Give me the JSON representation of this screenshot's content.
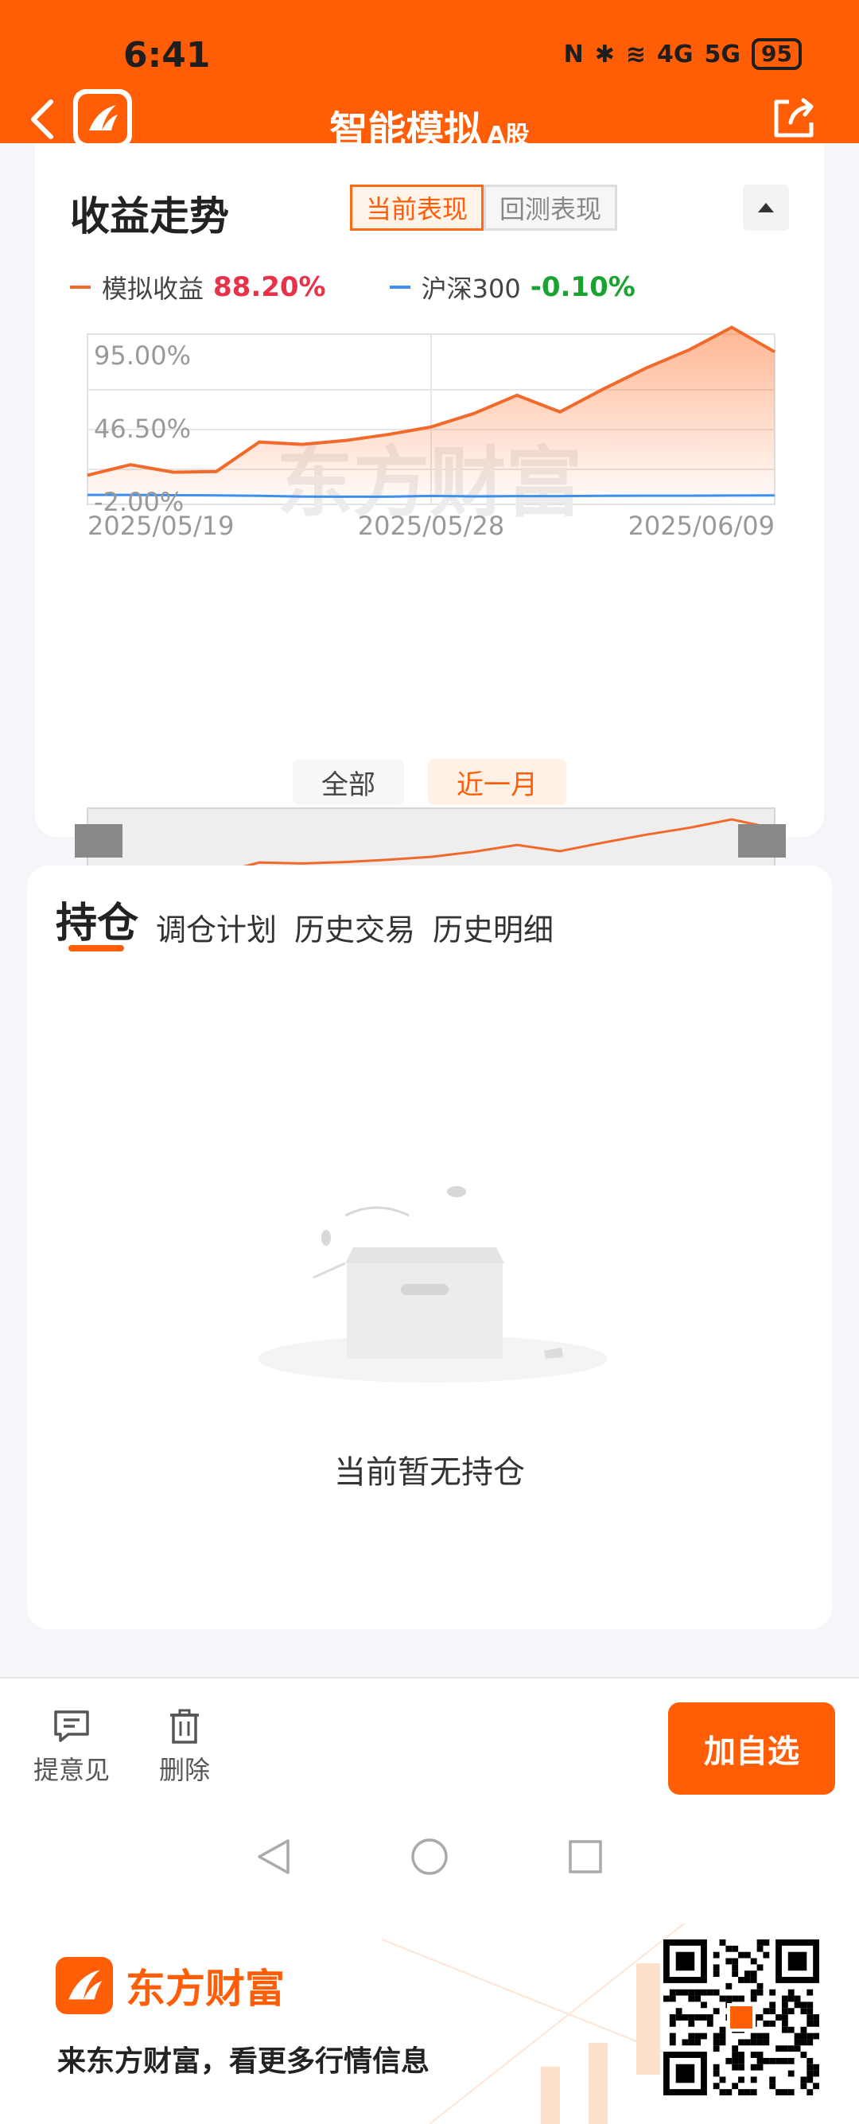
{
  "status_bar": {
    "time": "6:41",
    "network_4g": "4G",
    "network_5g": "5G",
    "battery": "95"
  },
  "header": {
    "title": "智能模拟",
    "title_suffix": "A股"
  },
  "returns_card": {
    "title": "收益走势",
    "tabs": [
      {
        "label": "当前表现",
        "active": true
      },
      {
        "label": "回测表现",
        "active": false
      }
    ],
    "legend": [
      {
        "name": "模拟收益",
        "value": "88.20%",
        "color": "#f26a2b",
        "value_color": "#e8324a"
      },
      {
        "name": "沪深300",
        "value": "-0.10%",
        "color": "#3f8ff0",
        "value_color": "#1aa331"
      }
    ],
    "watermark": "东方财富",
    "range_tabs": [
      {
        "label": "全部",
        "active": false
      },
      {
        "label": "近一月",
        "active": true
      }
    ]
  },
  "chart_data": {
    "type": "area",
    "y_tick_labels": [
      "95.00%",
      "46.50%",
      "-2.00%"
    ],
    "ylim": [
      -2.0,
      95.0
    ],
    "x_tick_labels": [
      "2025/05/19",
      "2025/05/28",
      "2025/06/09"
    ],
    "grid": true,
    "legend_position": "top-left",
    "series": [
      {
        "name": "模拟收益",
        "color": "#f26a2b",
        "values": [
          12,
          19,
          14,
          14.5,
          34,
          32.5,
          35,
          39,
          44,
          53,
          65,
          54,
          69,
          83,
          95,
          110,
          93.8
        ]
      },
      {
        "name": "沪深300",
        "color": "#3f8ff0",
        "values": [
          -1,
          -1,
          -1.2,
          -1.3,
          -1.6,
          -2.1,
          -2.2,
          -2.2,
          -1.7,
          -2.0,
          -1.8,
          -1.8,
          -1.6,
          -1.5,
          -1.5,
          -1.4,
          -1.3
        ]
      }
    ]
  },
  "holdings_card": {
    "tabs": [
      {
        "label": "持仓",
        "active": true
      },
      {
        "label": "调仓计划"
      },
      {
        "label": "历史交易"
      },
      {
        "label": "历史明细"
      }
    ],
    "empty_text": "当前暂无持仓"
  },
  "bottom_bar": {
    "feedback_label": "提意见",
    "delete_label": "删除",
    "add_label": "加自选"
  },
  "footer": {
    "brand": "东方财富",
    "slogan": "来东方财富，看更多行情信息"
  },
  "accent_color": "#ff5d06"
}
